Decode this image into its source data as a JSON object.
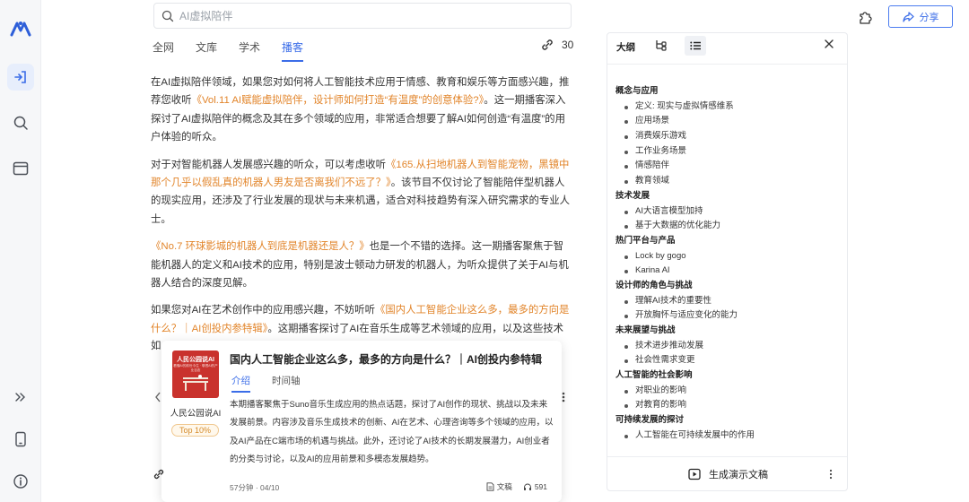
{
  "search": {
    "placeholder": "AI虚拟陪伴"
  },
  "header": {
    "share_label": "分享"
  },
  "tabs": [
    {
      "label": "全网"
    },
    {
      "label": "文库"
    },
    {
      "label": "学术"
    },
    {
      "label": "播客",
      "active": true
    }
  ],
  "link_count": "30",
  "article": {
    "p1_a": "在AI虚拟陪伴领域，如果您对如何将人工智能技术应用于情感、教育和娱乐等方面感兴趣，推荐您收听",
    "p1_link": "《Vol.11 AI赋能虚拟陪伴，设计师如何打造“有温度”的创意体验?》",
    "p1_b": "。这一期播客深入探讨了AI虚拟陪伴的概念及其在多个领域的应用，非常适合想要了解AI如何创造“有温度”的用户体验的听众。",
    "p2_a": "对于对智能机器人发展感兴趣的听众，可以考虑收听",
    "p2_link": "《165.从扫地机器人到智能宠物，黑镜中那个几乎以假乱真的机器人男友是否离我们不远了？》",
    "p2_b": "。该节目不仅讨论了智能陪伴型机器人的现实应用，还涉及了行业发展的现状与未来机遇，适合对科技趋势有深入研究需求的专业人士。",
    "p3_link": "《No.7 环球影城的机器人到底是机器还是人？》",
    "p3_b": "也是一个不错的选择。这一期播客聚焦于智能机器人的定义和AI技术的应用，特别是波士顿动力研发的机器人，为听众提供了关于AI与机器人结合的深度见解。",
    "p4_a": "如果您对AI在艺术创作中的应用感兴趣，不妨听听",
    "p4_link": "《国内人工智能企业这么多，最多的方向是什么？｜AI创投内参特辑》",
    "p4_b": "。这期播客探讨了AI在音乐生成等艺术领域的应用，以及这些技术",
    "p4_fade": "如"
  },
  "podcast_card": {
    "cover_title": "人民公园说AI",
    "cover_subtitle": "看懂AI的前世今生 · 聊透AI的产业百态",
    "podcast_name": "人民公园说AI",
    "badge": "Top 10%",
    "title": "国内人工智能企业这么多，最多的方向是什么？｜AI创投内参特辑",
    "tabs": [
      "介绍",
      "时间轴"
    ],
    "description": "本期播客聚焦于Suno音乐生成应用的热点话题，探讨了AI创作的现状、挑战以及未来发展前景。内容涉及音乐生成技术的创新、AI在艺术、心理咨询等多个领域的应用，以及AI产品在C端市场的机遇与挑战。此外，还讨论了AI技术的长期发展潜力，AI创业者的分类与讨论，以及AI的应用前景和多模态发展趋势。",
    "meta": "57分钟 · 04/10",
    "doc_label": "文稿",
    "listen_count": "591"
  },
  "outline": {
    "title": "大纲",
    "sections": [
      {
        "title": "概念与应用",
        "items": [
          "定义: 现实与虚拟情感维系",
          "应用场景",
          "消费娱乐游戏",
          "工作业务场景",
          "情感陪伴",
          "教育领域"
        ]
      },
      {
        "title": "技术发展",
        "items": [
          "AI大语言模型加持",
          "基于大数据的优化能力"
        ]
      },
      {
        "title": "热门平台与产品",
        "items": [
          "Lock by gogo",
          "Karina AI"
        ]
      },
      {
        "title": "设计师的角色与挑战",
        "items": [
          "理解AI技术的重要性",
          "开放胸怀与适应变化的能力"
        ]
      },
      {
        "title": "未来展望与挑战",
        "items": [
          "技术进步推动发展",
          "社会性需求变更"
        ]
      },
      {
        "title": "人工智能的社会影响",
        "items": [
          "对职业的影响",
          "对教育的影响"
        ]
      },
      {
        "title": "可持续发展的探讨",
        "items": [
          "人工智能在可持续发展中的作用"
        ]
      }
    ],
    "generate_label": "生成演示文稿"
  },
  "colors": {
    "accent": "#3b6de8",
    "link": "#e2852b",
    "badge": "#d58b2a",
    "cover": "#c9322d"
  }
}
